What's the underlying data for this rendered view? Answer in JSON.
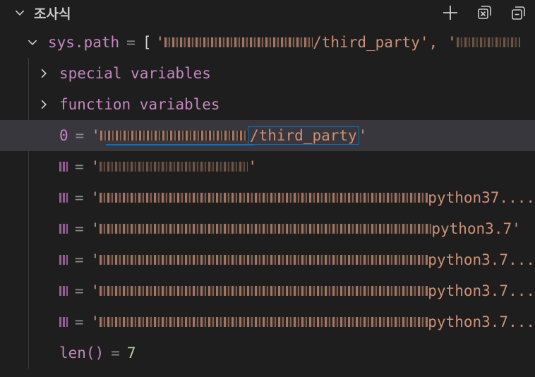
{
  "panel": {
    "title": "조사식",
    "actions": [
      {
        "name": "add-expression-button",
        "icon": "plus-icon"
      },
      {
        "name": "collapse-all-button",
        "icon": "collapse-icon"
      },
      {
        "name": "remove-all-button",
        "icon": "close-all-icon"
      }
    ]
  },
  "watch": {
    "expression": "sys.path",
    "equals": "=",
    "summary_open": "[",
    "summary_first_tail": "/third_party',",
    "summary_second_head": "'/home/...",
    "groups": [
      {
        "label": "special variables"
      },
      {
        "label": "function variables"
      }
    ],
    "items": [
      {
        "index": "0",
        "prefix": "'",
        "tail": "/third_party",
        "close": "'"
      },
      {
        "index": "1",
        "prefix": "'",
        "tail": "'",
        "close": ""
      },
      {
        "index": "2",
        "prefix": "'",
        "tail": "python37....",
        "close": ""
      },
      {
        "index": "3",
        "prefix": "'",
        "tail": "python3.7'",
        "close": ""
      },
      {
        "index": "4",
        "prefix": "'",
        "tail": "python3.7...",
        "close": ""
      },
      {
        "index": "5",
        "prefix": "'",
        "tail": "python3.7...",
        "close": ""
      },
      {
        "index": "6",
        "prefix": "'",
        "tail": "python3.7...",
        "close": ""
      }
    ],
    "len_label": "len()",
    "len_value": "7"
  },
  "colors": {
    "background": "#1e1e1e",
    "selection": "#37373d",
    "focus_border": "#0e70c0",
    "name": "#c586c0",
    "string": "#ce9178",
    "number": "#b5cea8"
  }
}
